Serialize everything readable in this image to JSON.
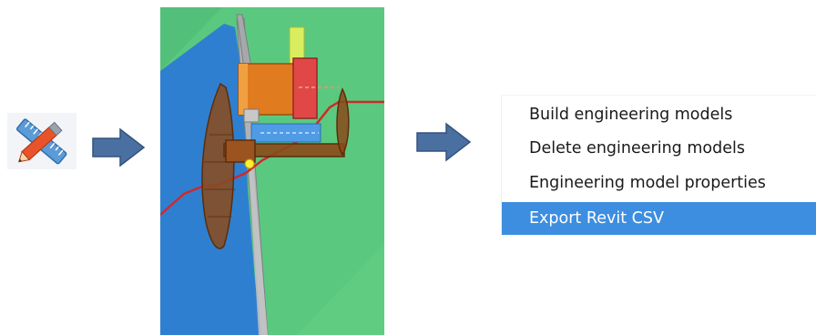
{
  "toolbar": {
    "tool_icon": "edit-engineering-models-icon"
  },
  "flow_arrows": [
    "arrow-right-icon",
    "arrow-right-icon"
  ],
  "model_view": {
    "description_icon": "engineering-model-3d-view",
    "colors": {
      "terrain": "#5ac97f",
      "water": "#2f7fd1",
      "cable": "#d0292a",
      "structure_brown": "#8b4a1a",
      "pipe_blue": "#4f9be6",
      "highlight_yellow": "#ffee33"
    }
  },
  "context_menu": {
    "items": [
      {
        "label": "Build engineering models",
        "highlighted": false
      },
      {
        "label": "Delete engineering models",
        "highlighted": false
      },
      {
        "label": "Engineering model properties",
        "highlighted": false
      },
      {
        "label": "Export Revit CSV",
        "highlighted": true
      }
    ],
    "highlight_color": "#3d8ee0"
  }
}
